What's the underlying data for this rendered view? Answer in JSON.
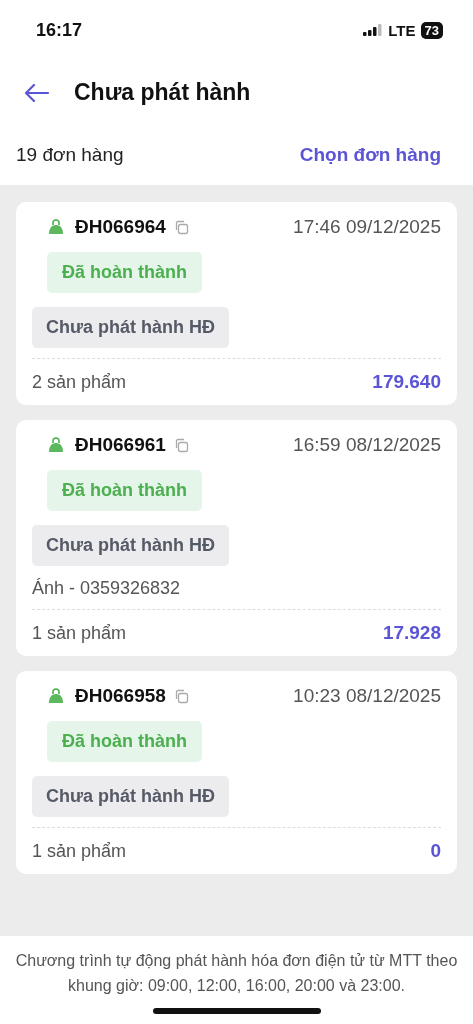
{
  "status_bar": {
    "time": "16:17",
    "network": "LTE",
    "battery": "73"
  },
  "header": {
    "title": "Chưa phát hành"
  },
  "summary": {
    "count": "19 đơn hàng",
    "action": "Chọn đơn hàng"
  },
  "orders": [
    {
      "code": "ĐH066964",
      "datetime": "17:46 09/12/2025",
      "status": "Đã hoàn thành",
      "invoice_status": "Chưa phát hành HĐ",
      "products": "2 sản phẩm",
      "total": "179.640"
    },
    {
      "code": "ĐH066961",
      "datetime": "16:59 08/12/2025",
      "status": "Đã hoàn thành",
      "invoice_status": "Chưa phát hành HĐ",
      "customer": "Ánh - 0359326832",
      "products": "1 sản phẩm",
      "total": "17.928"
    },
    {
      "code": "ĐH066958",
      "datetime": "10:23 08/12/2025",
      "status": "Đã hoàn thành",
      "invoice_status": "Chưa phát hành HĐ",
      "products": "1 sản phẩm",
      "total": "0"
    }
  ],
  "footer_note": "Chương trình tự động phát hành hóa đơn điện tử từ MTT theo khung giờ: 09:00, 12:00, 16:00, 20:00 và 23:00."
}
